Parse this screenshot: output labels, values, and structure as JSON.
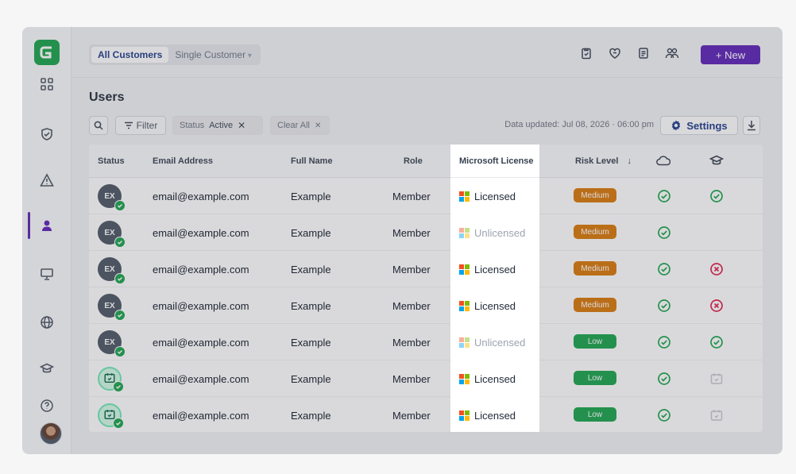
{
  "app": {
    "seg_tabs": [
      "All Customers",
      "Single Customer"
    ],
    "new_button": "+ New"
  },
  "page": {
    "title": "Users",
    "filter_label": "Filter",
    "chip_status_key": "Status",
    "chip_status_value": "Active",
    "chip_clear": "Clear All",
    "updated": "Data updated: Jul 08, 2026 · 06:00 pm",
    "settings": "Settings"
  },
  "table": {
    "headers": [
      "Status",
      "Email Address",
      "Full Name",
      "Role",
      "Microsoft License",
      "Risk Level"
    ],
    "rows": [
      {
        "avatar": "EX",
        "email": "email@example.com",
        "name": "Example",
        "role": "Member",
        "license": "Licensed",
        "licensed": true,
        "risk": "Medium",
        "col2": "ok"
      },
      {
        "avatar": "EX",
        "email": "email@example.com",
        "name": "Example",
        "role": "Member",
        "license": "Unlicensed",
        "licensed": false,
        "risk": "Medium",
        "col2": "none"
      },
      {
        "avatar": "EX",
        "email": "email@example.com",
        "name": "Example",
        "role": "Member",
        "license": "Licensed",
        "licensed": true,
        "risk": "Medium",
        "col2": "fail"
      },
      {
        "avatar": "EX",
        "email": "email@example.com",
        "name": "Example",
        "role": "Member",
        "license": "Licensed",
        "licensed": true,
        "risk": "Medium",
        "col2": "fail"
      },
      {
        "avatar": "EX",
        "email": "email@example.com",
        "name": "Example",
        "role": "Member",
        "license": "Unlicensed",
        "licensed": false,
        "risk": "Low",
        "col2": "ok"
      },
      {
        "avatar": "",
        "email": "email@example.com",
        "name": "Example",
        "role": "Member",
        "license": "Licensed",
        "licensed": true,
        "risk": "Low",
        "col2": "calendar"
      },
      {
        "avatar": "",
        "email": "email@example.com",
        "name": "Example",
        "role": "Member",
        "license": "Licensed",
        "licensed": true,
        "risk": "Low",
        "col2": "calendar"
      }
    ]
  },
  "colors": {
    "accent": "#5b21b6",
    "brand": "#16a34a",
    "risk_medium": "#d97706",
    "risk_low": "#16a34a",
    "ok": "#16a34a",
    "fail": "#e11d48"
  },
  "icons": {
    "sidebar": [
      "dashboard-icon",
      "shield-icon",
      "alert-icon",
      "users-icon",
      "monitor-icon",
      "globe-icon",
      "graduation-cap-icon",
      "help-icon"
    ],
    "topbar": [
      "clipboard-icon",
      "heart-shield-icon",
      "document-icon",
      "people-icon"
    ]
  }
}
